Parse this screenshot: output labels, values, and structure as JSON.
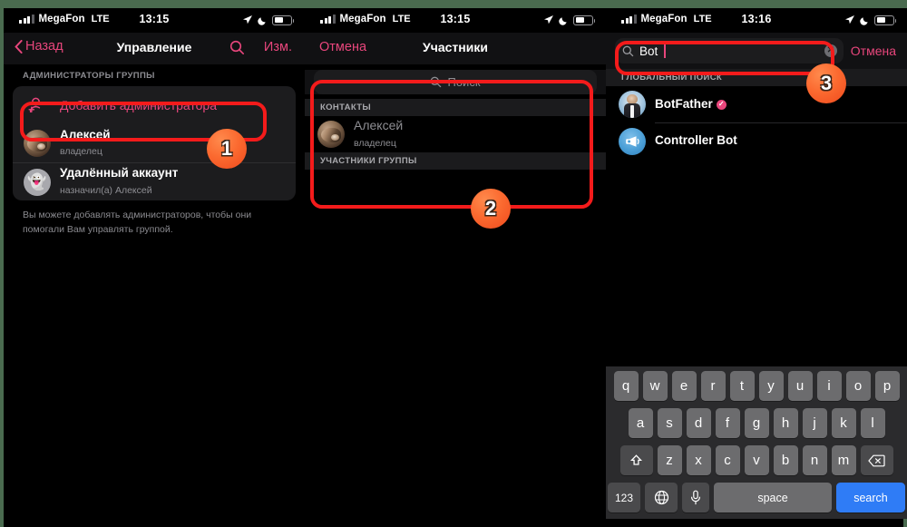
{
  "accent": "#e8467c",
  "highlight_color": "#f41b1b",
  "badge_color": "#fb6a30",
  "panel1": {
    "status": {
      "carrier": "MegaFon",
      "network": "LTE",
      "time": "13:15"
    },
    "nav": {
      "back": "Назад",
      "title": "Управление",
      "edit": "Изм."
    },
    "section_header": "АДМИНИСТРАТОРЫ ГРУППЫ",
    "add_admin": "Добавить администратора",
    "admins": [
      {
        "name": "Алексей",
        "subtitle": "владелец",
        "avatar": "cat-photo-avatar"
      },
      {
        "name": "Удалённый аккаунт",
        "subtitle": "назначил(а) Алексей",
        "avatar": "ghost-avatar"
      }
    ],
    "footnote": "Вы можете добавлять администраторов, чтобы они помогали Вам управлять группой."
  },
  "panel2": {
    "status": {
      "carrier": "MegaFon",
      "network": "LTE",
      "time": "13:15"
    },
    "nav": {
      "cancel": "Отмена",
      "title": "Участники"
    },
    "search_placeholder": "Поиск",
    "sections": [
      {
        "header": "КОНТАКТЫ",
        "rows": [
          {
            "name": "Алексей",
            "subtitle": "владелец",
            "avatar": "cat-photo-avatar"
          }
        ]
      },
      {
        "header": "УЧАСТНИКИ ГРУППЫ",
        "rows": []
      }
    ]
  },
  "panel3": {
    "status": {
      "carrier": "MegaFon",
      "network": "LTE",
      "time": "13:16"
    },
    "search_value": "Bot",
    "cancel": "Отмена",
    "section_header": "ГЛОБАЛЬНЫЙ ПОИСК",
    "results": [
      {
        "name": "BotFather",
        "verified": true,
        "verified_glyph": "✓",
        "avatar": "botfather-avatar"
      },
      {
        "name": "Controller Bot",
        "verified": false,
        "avatar": "megaphone-avatar"
      }
    ],
    "keyboard": {
      "row1": [
        "q",
        "w",
        "e",
        "r",
        "t",
        "y",
        "u",
        "i",
        "o",
        "p"
      ],
      "row2": [
        "a",
        "s",
        "d",
        "f",
        "g",
        "h",
        "j",
        "k",
        "l"
      ],
      "row3": [
        "z",
        "x",
        "c",
        "v",
        "b",
        "n",
        "m"
      ],
      "shift": "shift-icon",
      "backspace": "backspace-icon",
      "numbers": "123",
      "globe": "globe-icon",
      "mic": "microphone-icon",
      "space": "space",
      "submit": "search"
    }
  },
  "annotations": {
    "step1": "1",
    "step2": "2",
    "step3": "3"
  }
}
